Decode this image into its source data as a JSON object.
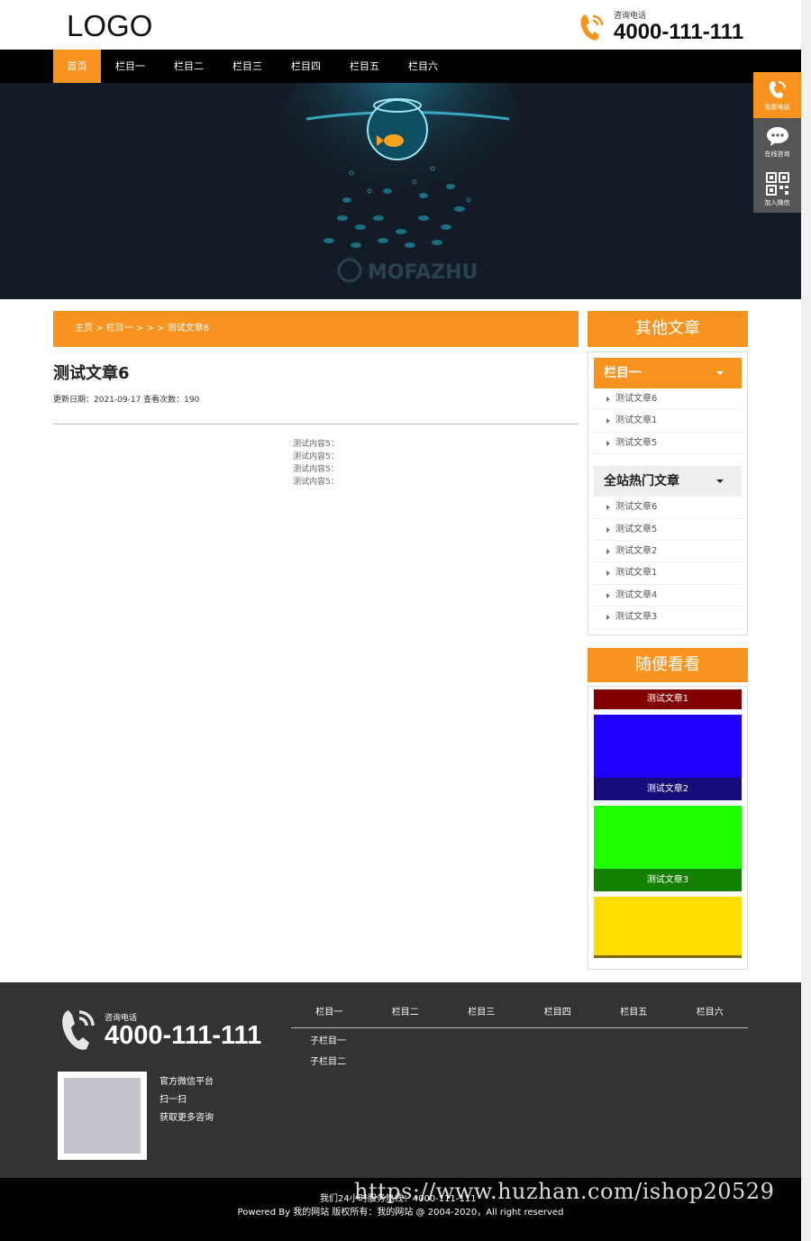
{
  "header": {
    "logo": "LOGO",
    "hotline_label": "咨询电话",
    "hotline_number": "4000-111-111"
  },
  "nav": [
    "首页",
    "栏目一",
    "栏目二",
    "栏目三",
    "栏目四",
    "栏目五",
    "栏目六"
  ],
  "banner": {
    "brand": "MOFAZHU"
  },
  "float_bar": [
    "免费电话",
    "在线咨询",
    "加入微信"
  ],
  "breadcrumb": "主页 > 栏目一 > > > 测试文章6",
  "article": {
    "title": "测试文章6",
    "meta": "更新日期：2021-09-17 查看次数：190",
    "body": [
      "测试内容5：",
      "测试内容5：",
      "测试内容5：",
      "测试内容5："
    ]
  },
  "sidebar": {
    "heading": "其他文章",
    "category_title": "栏目一",
    "category_items": [
      "测试文章6",
      "测试文章1",
      "测试文章5"
    ],
    "hot_title": "全站热门文章",
    "hot_items": [
      "测试文章6",
      "测试文章5",
      "测试文章2",
      "测试文章1",
      "测试文章4",
      "测试文章3"
    ],
    "random_heading": "随便看看",
    "random_items": [
      "测试文章1",
      "测试文章2",
      "测试文章3"
    ]
  },
  "footer": {
    "hotline_label": "咨询电话",
    "hotline_number": "4000-111-111",
    "nav": [
      "栏目一",
      "栏目二",
      "栏目三",
      "栏目四",
      "栏目五",
      "栏目六"
    ],
    "sub": [
      "子栏目一",
      "子栏目二"
    ],
    "qr_text": [
      "官方微信平台",
      "扫一扫",
      "获取更多咨询"
    ],
    "service": "我们24小时服务热线：4000-111-111",
    "copyright": "Powered By 我的网站 版权所有：我的网站 @ 2004-2020，All right reserved",
    "watermark": "https://www.huzhan.com/ishop20529"
  },
  "colors": {
    "accent": "#f7931e",
    "nav_bg": "#000000",
    "footer_bg": "#333333"
  }
}
